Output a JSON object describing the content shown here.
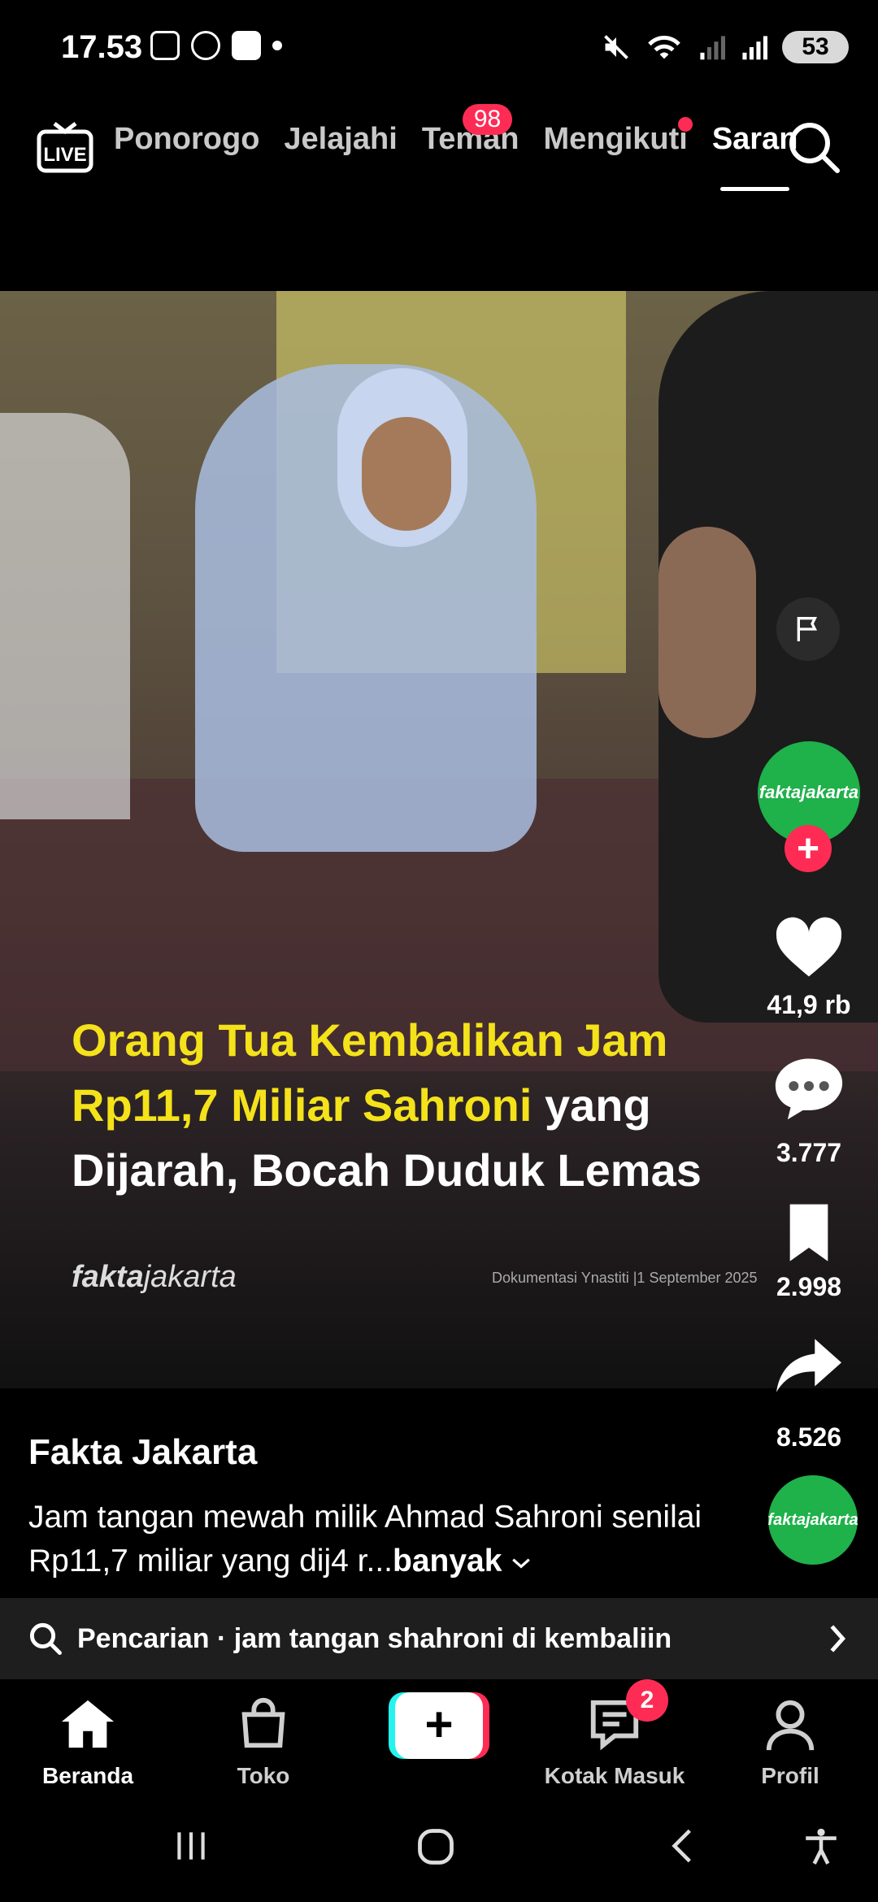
{
  "status_bar": {
    "time": "17.53",
    "battery": "53"
  },
  "top_nav": {
    "live_label": "LIVE",
    "tabs": [
      {
        "label": "Ponorogo"
      },
      {
        "label": "Jelajahi"
      },
      {
        "label": "Teman",
        "badge": "98"
      },
      {
        "label": "Mengikuti"
      },
      {
        "label": "Saran",
        "active": true
      }
    ]
  },
  "video": {
    "caption_yellow_1": "Orang Tua Kembalikan Jam",
    "caption_yellow_2": "Rp11,7 Miliar Sahroni",
    "caption_white_1": " yang",
    "caption_white_2": "Dijarah, Bocah Duduk Lemas",
    "brand_a": "fakta",
    "brand_b": "jakarta",
    "doc_credit": "Dokumentasi Ynastiti  |1 September 2025"
  },
  "rail": {
    "avatar_text_1": "fakta",
    "avatar_text_2": "jakarta",
    "likes": "41,9 rb",
    "comments": "3.777",
    "saves": "2.998",
    "shares": "8.526"
  },
  "info": {
    "author": "Fakta Jakarta",
    "description": "Jam tangan mewah milik Ahmad Sahroni senilai Rp11,7 miliar yang dij4 r...",
    "more_label": "banyak"
  },
  "search_suggestion": {
    "text": "Pencarian · jam tangan shahroni di kembaliin"
  },
  "bottom_nav": {
    "home": "Beranda",
    "shop": "Toko",
    "inbox": "Kotak Masuk",
    "inbox_badge": "2",
    "profile": "Profil"
  },
  "colors": {
    "accent": "#fe2c55",
    "cyan": "#25f4ee",
    "avatar_green": "#1fb14a",
    "caption_yellow": "#f4e21a"
  }
}
